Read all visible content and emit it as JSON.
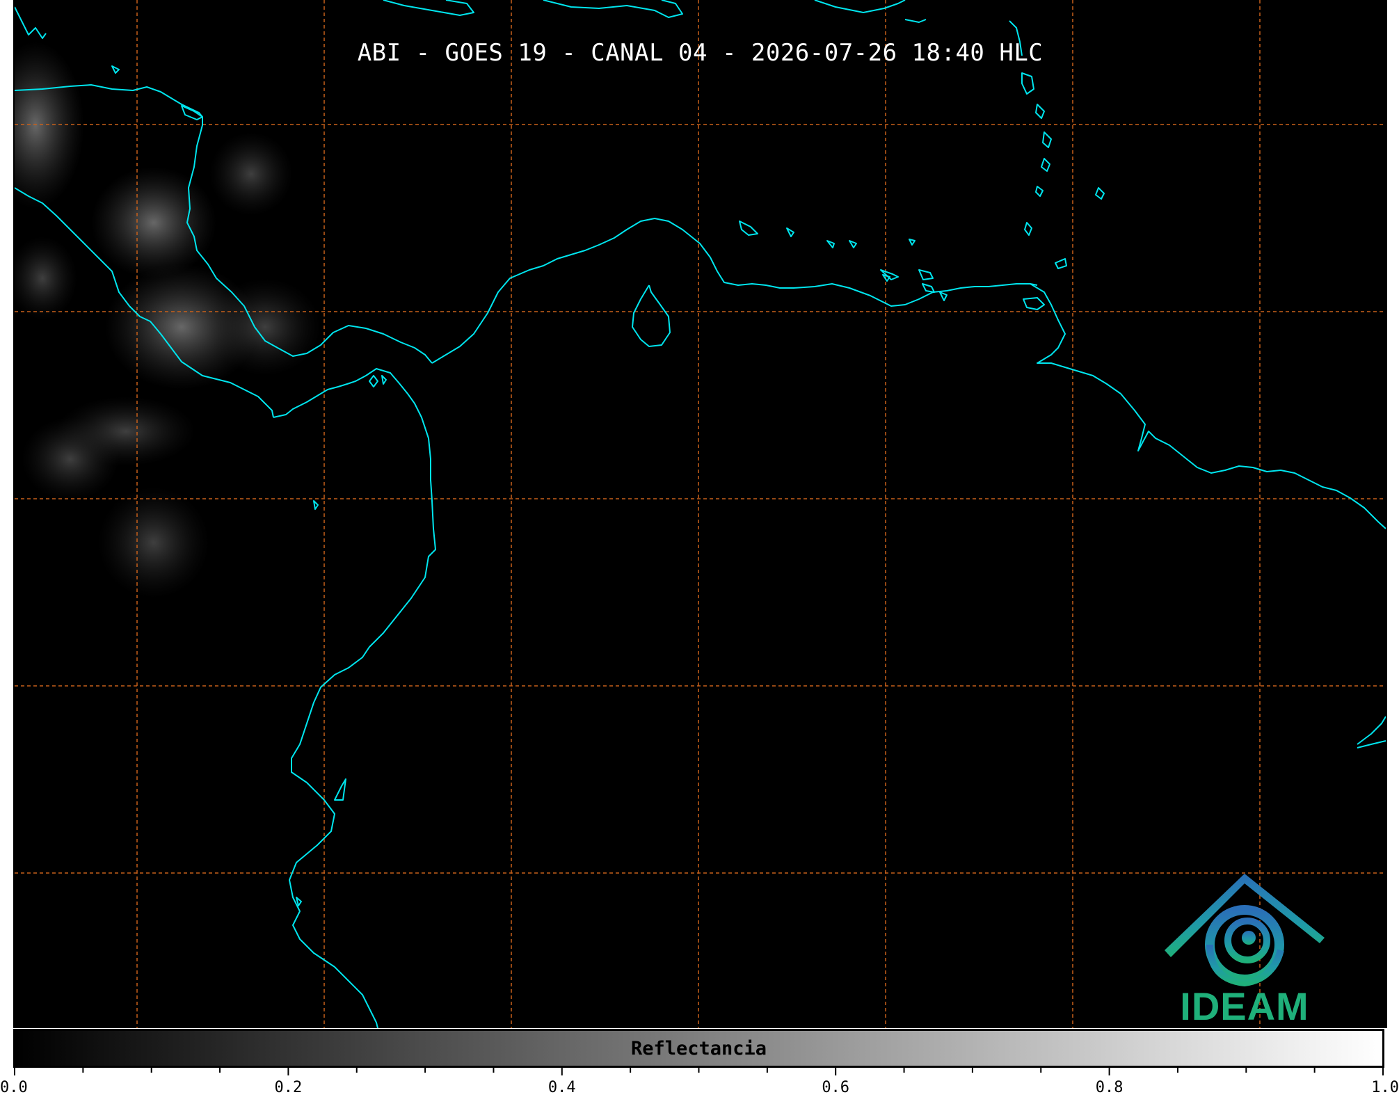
{
  "title": "ABI - GOES 19 - CANAL 04 - 2026-07-26 18:40 HLC",
  "colorbar": {
    "label": "Reflectancia",
    "min": 0.0,
    "max": 1.0,
    "gradient_start": "#000000",
    "gradient_end": "#ffffff",
    "major_ticks": [
      "0.0",
      "0.2",
      "0.4",
      "0.6",
      "0.8",
      "1.0"
    ],
    "minor_step": 0.05
  },
  "map": {
    "background": "#000000",
    "coastline_color": "#00e5ee",
    "grid_color": "#c8601a",
    "grid_style": "dashed",
    "grid_columns": 7,
    "grid_rows": 5
  },
  "logo": {
    "text": "IDEAM",
    "icon": "ideam-logo-icon",
    "color_top": "#2a6fb8",
    "color_bottom": "#1fb07a"
  }
}
